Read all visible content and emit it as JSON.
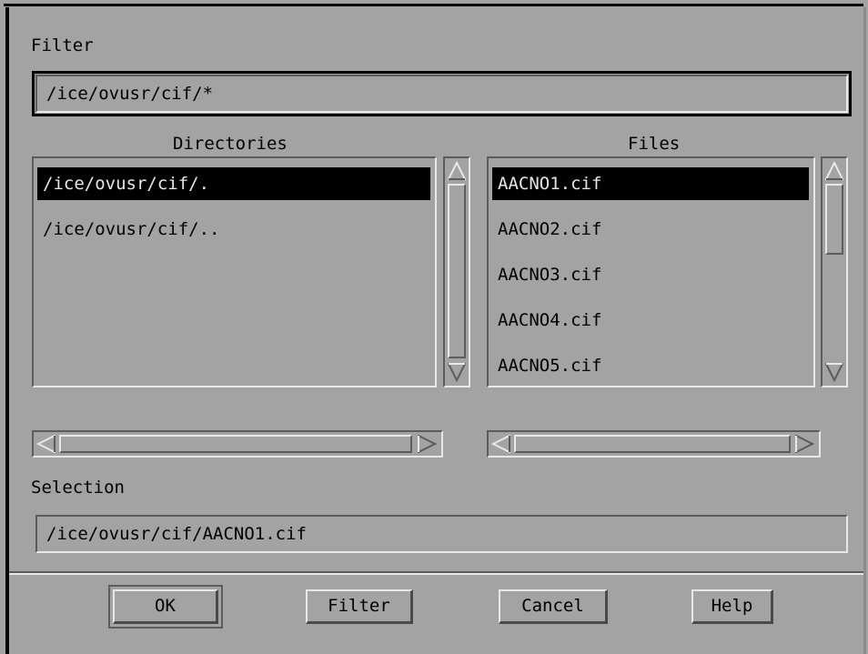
{
  "dialog": {
    "filter_label": "Filter",
    "filter_value": "/ice/ovusr/cif/*",
    "directories_label": "Directories",
    "files_label": "Files",
    "directories": [
      "/ice/ovusr/cif/.",
      "/ice/ovusr/cif/.."
    ],
    "files": [
      "AACNO1.cif",
      "AACNO2.cif",
      "AACNO3.cif",
      "AACNO4.cif",
      "AACNO5.cif"
    ],
    "selected_directory": "/ice/ovusr/cif/.",
    "selected_file": "AACNO1.cif",
    "selection_label": "Selection",
    "selection_value": "/ice/ovusr/cif/AACNO1.cif"
  },
  "buttons": {
    "ok": "OK",
    "filter": "Filter",
    "cancel": "Cancel",
    "help": "Help"
  },
  "icons": {
    "up": "arrow-up-icon",
    "down": "arrow-down-icon",
    "left": "arrow-left-icon",
    "right": "arrow-right-icon"
  },
  "colors": {
    "background": "#a3a3a3",
    "highlight": "#e8e8e8",
    "shadow": "#5c5c5c",
    "selection_bg": "#000000",
    "selection_fg": "#e6e6e6"
  }
}
